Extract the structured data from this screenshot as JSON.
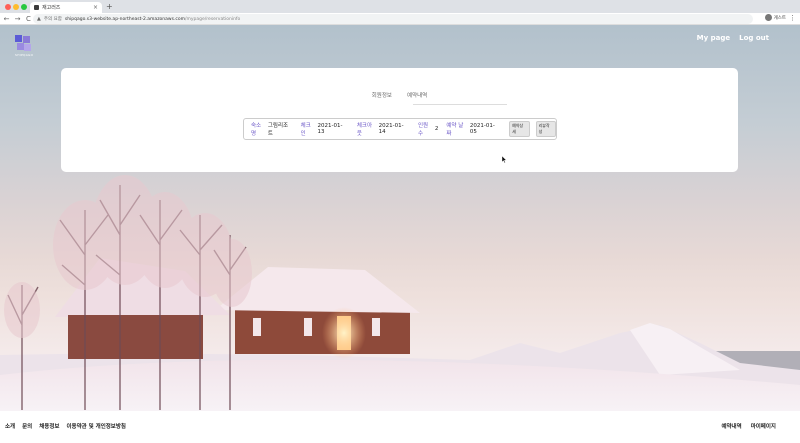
{
  "browser": {
    "tab_title": "재고러즈",
    "tab_close": "×",
    "new_tab": "+",
    "back": "←",
    "forward": "→",
    "reload": "C",
    "security_icon": "warning-icon",
    "security_text": "주의 요함",
    "url_host": "shipqago.s3-website.ap-northeast-2.amazonaws.com",
    "url_path": "/mypage/reservationinfo",
    "profile_name": "게스트",
    "menu": "⋮"
  },
  "site": {
    "logo_text": "SHIPQAGO",
    "nav": {
      "mypage": "My page",
      "logout": "Log out"
    },
    "colors": {
      "accent": "#6a56c7"
    }
  },
  "card": {
    "tabs": [
      "회원정보",
      "예약내역"
    ],
    "reservation": {
      "place_label": "숙소명",
      "place_value": "그림리조트",
      "checkin_label": "체크인",
      "checkin_value": "2021-01-13",
      "checkout_label": "체크아웃",
      "checkout_value": "2021-01-14",
      "guests_label": "인원수",
      "guests_value": "2",
      "reserved_label": "예약 날짜",
      "reserved_value": "2021-01-05",
      "detail_button": "예약상세",
      "review_button": "리뷰작성"
    }
  },
  "footer": {
    "left": [
      "소개",
      "문의",
      "채용정보",
      "이용약관 및 개인정보방침"
    ],
    "right": [
      "예약내역",
      "마이페이지"
    ]
  }
}
